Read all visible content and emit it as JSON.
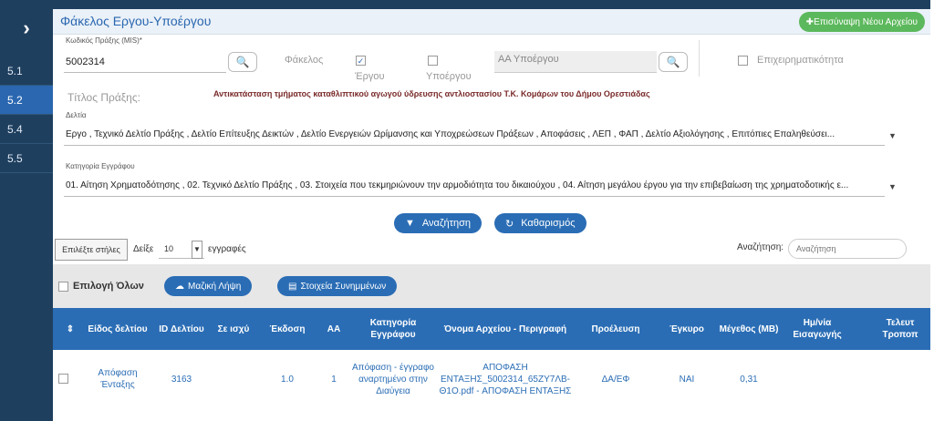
{
  "nav": {
    "toggle": "›",
    "items": [
      "5.1",
      "5.2",
      "5.4",
      "5.5"
    ]
  },
  "header": {
    "title": "Φάκελος Εργου-Υποέργου",
    "upload_btn": "Επισύναψη Νέου Αρχείου"
  },
  "form": {
    "mis_label": "Κωδικός Πράξης (MIS)*",
    "mis_value": "5002314",
    "folder_label": "Φάκελος",
    "cb_ergou": "Έργου",
    "cb_ypoergou": "Υποέργου",
    "aa_placeholder": "ΑΑ Υποέργου",
    "business_label": "Επιχειρηματικότητα",
    "title_label": "Τίτλος Πράξης:",
    "title_value": "Αντικατάσταση τμήματος καταθλιπτικού αγωγού ύδρευσης αντλιοστασίου Τ.Κ. Κομάρων του Δήμου Ορεστιάδας",
    "deltia_label": "Δελτία",
    "deltia_value": "Εργο , Τεχνικό Δελτίο Πράξης , Δελτίο Επίτευξης Δεικτών , Δελτίο Ενεργειών Ωρίμανσης και Υποχρεώσεων Πράξεων , Αποφάσεις , ΛΕΠ , ΦΑΠ , Δελτίο Αξιολόγησης , Επιτόπιες Επαληθεύσει...",
    "category_label": "Κατηγορία Εγγράφου",
    "category_value": "01. Αίτηση Χρηματοδότησης , 02. Τεχνικό Δελτίο Πράξης , 03. Στοιχεία που τεκμηριώνουν την αρμοδιότητα του δικαιούχου , 04. Αίτηση μεγάλου έργου για την επιβεβαίωση της χρηματοδοτικής ε..."
  },
  "actions": {
    "search": "Αναζήτηση",
    "clear": "Καθαρισμός"
  },
  "table_tools": {
    "columns_btn": "Επιλέξτε στήλες",
    "show": "Δείξε",
    "page_size": "10",
    "records": "εγγραφές",
    "search_label": "Αναζήτηση:",
    "search_placeholder": "Αναζήτηση"
  },
  "bulk": {
    "select_all": "Επιλογή Όλων",
    "bulk_download": "Μαζική Λήψη",
    "attachments": "Στοιχεία Συνημμένων"
  },
  "columns": [
    "Είδος δελτίου",
    "ID Δελτίου",
    "Σε ισχύ",
    "Έκδοση",
    "ΑΑ",
    "Κατηγορία Εγγράφου",
    "Όνομα Αρχείου - Περιγραφή",
    "Προέλευση",
    "Έγκυρο",
    "Μέγεθος (MB)",
    "Ημ/νία Εισαγωγής",
    "Τελευτ Τροποπ"
  ],
  "row": {
    "eidos": "Απόφαση Ένταξης",
    "id": "3163",
    "se_isxy": "",
    "ekdosi": "1.0",
    "aa": "1",
    "kategoria": "Απόφαση - έγγραφο αναρτημένο στην Διαύγεια",
    "onoma": "ΑΠΟΦΑΣΗ ΕΝΤΑΞΗΣ_5002314_65ΖΥ7ΛΒ-Θ1Ο.pdf - ΑΠΟΦΑΣΗ ΕΝΤΑΞΗΣ",
    "proeleusi": "ΔΑ/ΕΦ",
    "egkyro": "ΝΑΙ",
    "megethos": "0,31"
  },
  "colors": {
    "nav": "#1f3f5f",
    "accent": "#2a6db5",
    "green": "#5cb85c"
  }
}
